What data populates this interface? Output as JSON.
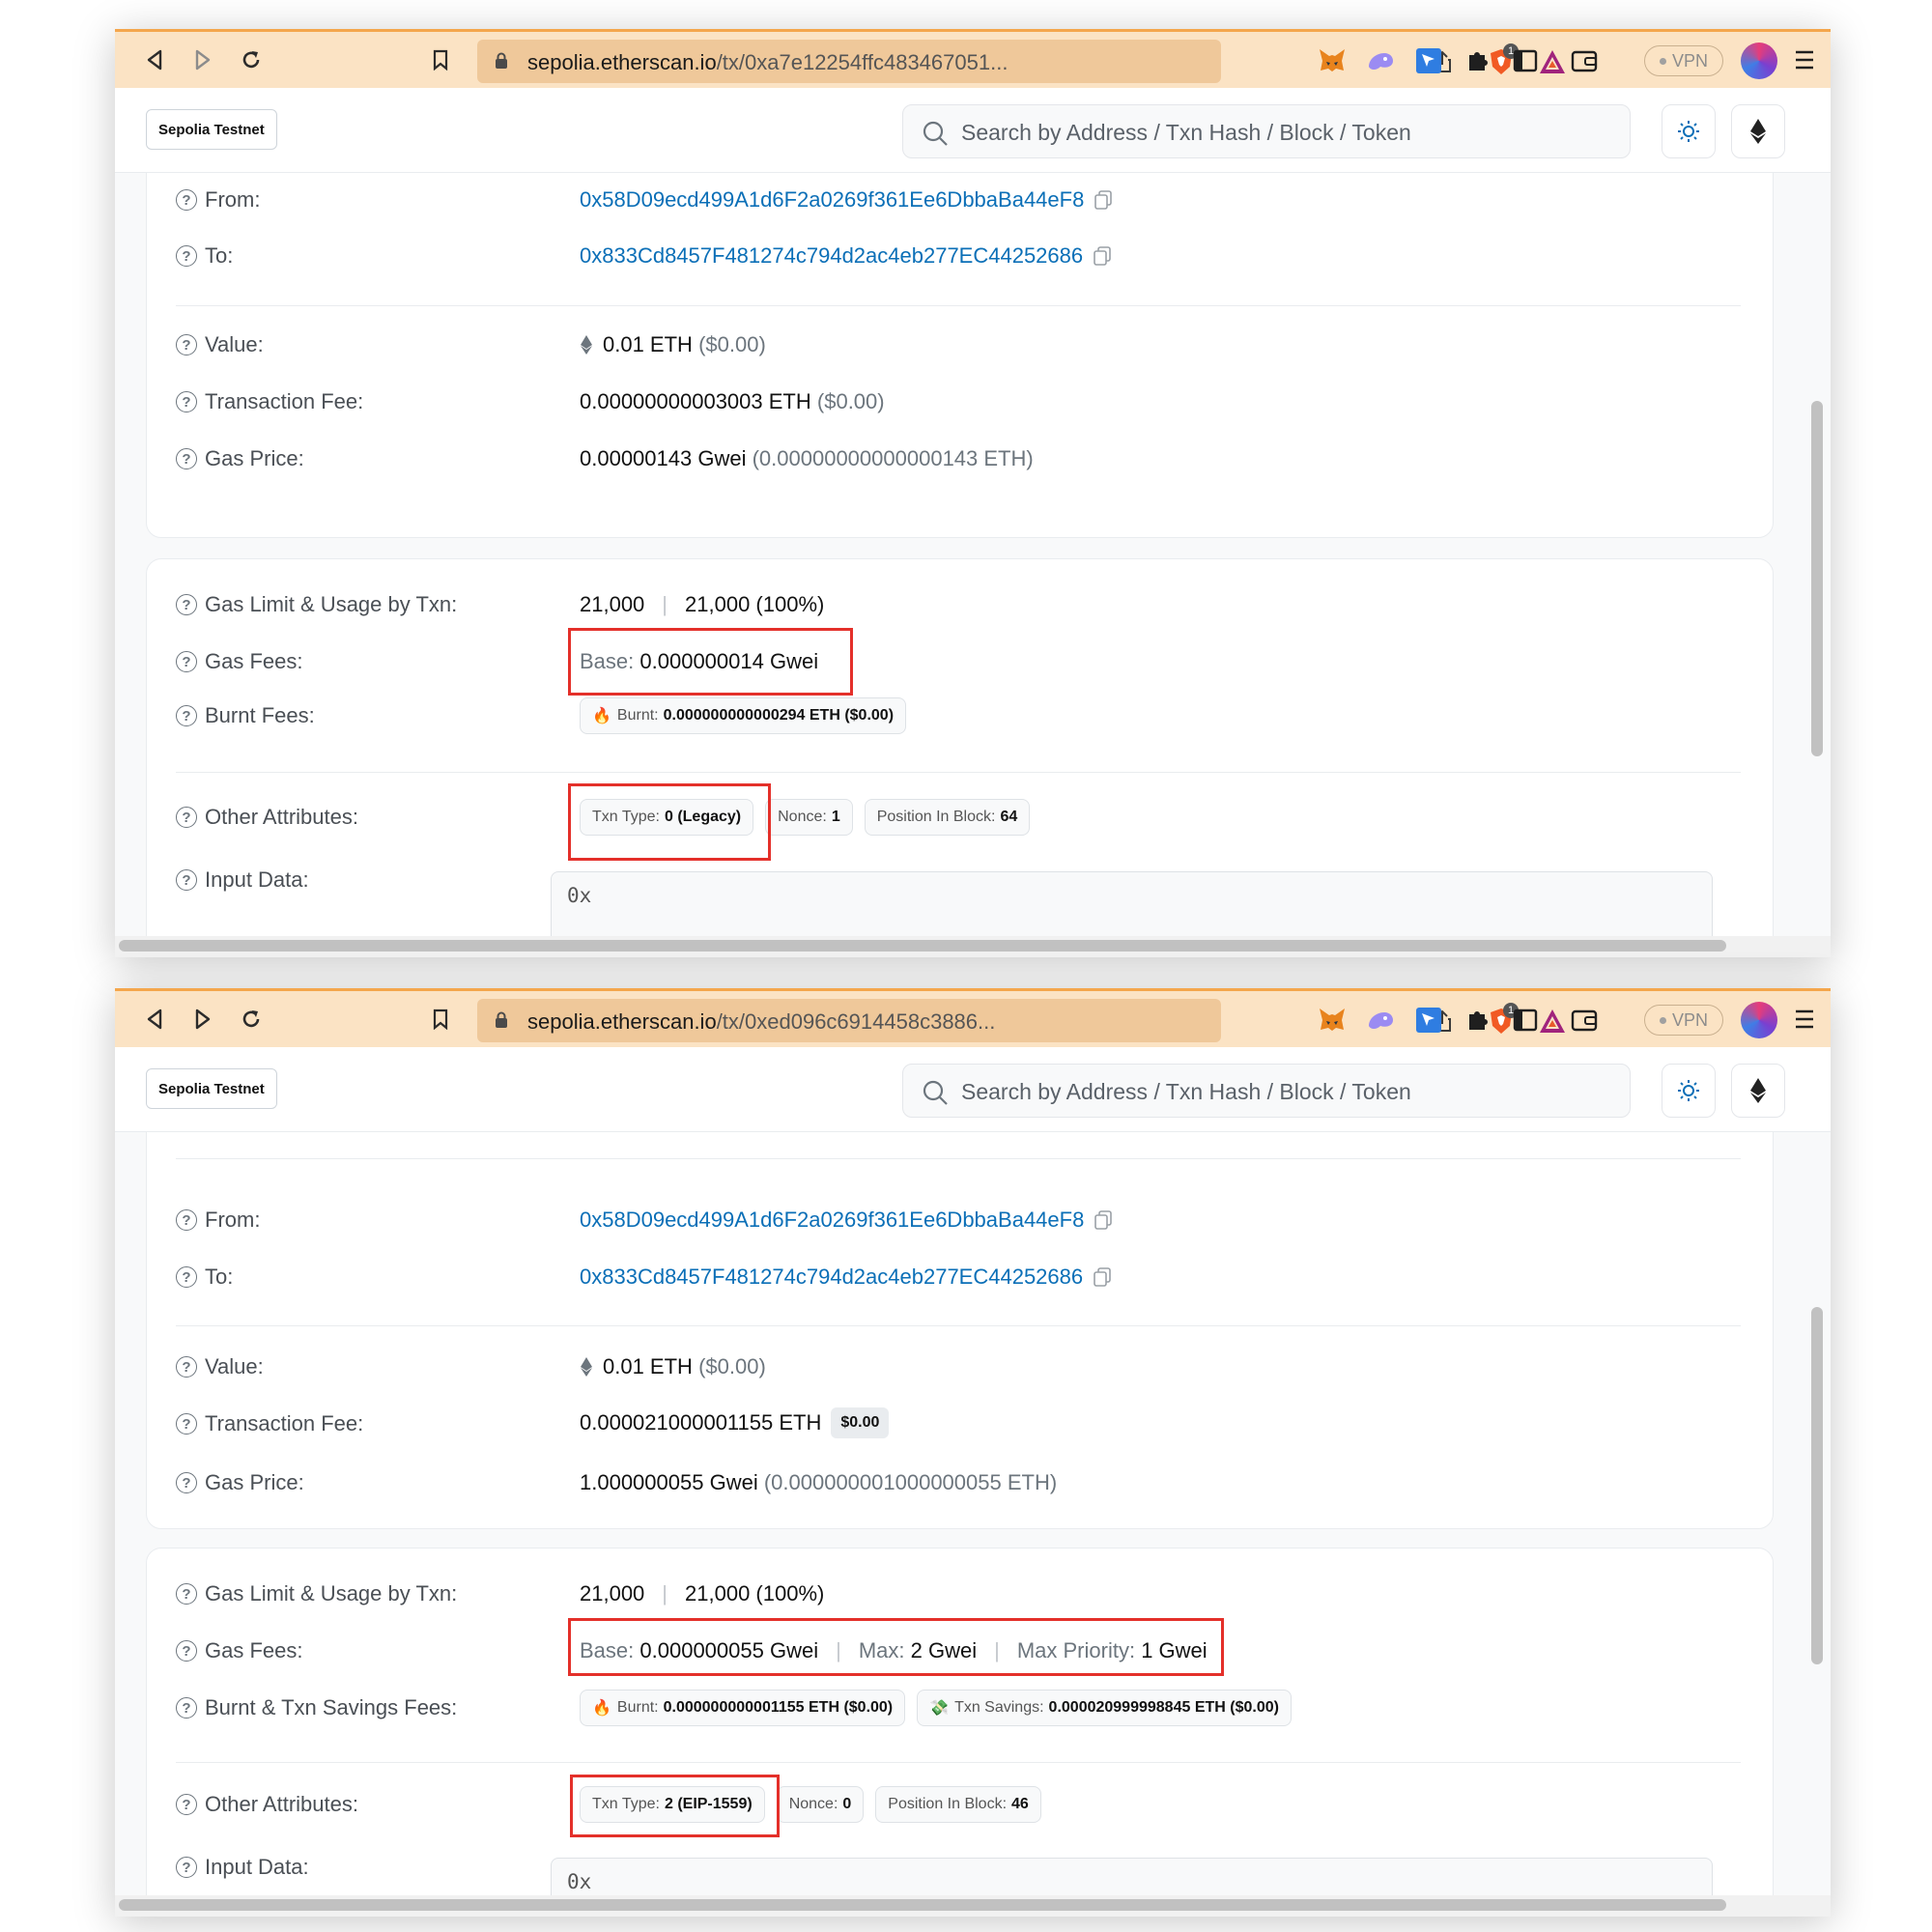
{
  "browser": {
    "urls": [
      {
        "host": "sepolia.etherscan.io",
        "path": "/tx/0xa7e12254ffc483467051..."
      },
      {
        "host": "sepolia.etherscan.io",
        "path": "/tx/0xed096c6914458c3886..."
      }
    ],
    "shields_count": "1",
    "vpn_label": "VPN"
  },
  "header": {
    "network_label": "Sepolia Testnet",
    "search_placeholder": "Search by Address / Txn Hash / Block / Token"
  },
  "labels": {
    "from": "From:",
    "to": "To:",
    "value": "Value:",
    "txn_fee": "Transaction Fee:",
    "gas_price": "Gas Price:",
    "gas_limit": "Gas Limit & Usage by Txn:",
    "gas_fees": "Gas Fees:",
    "burnt_fees": "Burnt Fees:",
    "burnt_savings_fees": "Burnt & Txn Savings Fees:",
    "other_attrs": "Other Attributes:",
    "input_data": "Input Data:",
    "base": "Base:",
    "max": "Max:",
    "max_priority": "Max Priority:",
    "burnt": "Burnt:",
    "txn_savings": "Txn Savings:",
    "txn_type": "Txn Type:",
    "nonce": "Nonce:",
    "position": "Position In Block:"
  },
  "tx1": {
    "from": "0x58D09ecd499A1d6F2a0269f361Ee6DbbaBa44eF8",
    "to": "0x833Cd8457F481274c794d2ac4eb277EC44252686",
    "value": "0.01 ETH",
    "value_usd": "($0.00)",
    "fee": "0.00000000003003 ETH",
    "fee_usd": "($0.00)",
    "gas_price": "0.00000143 Gwei",
    "gas_price_eth": "(0.00000000000000143 ETH)",
    "gas_limit": "21,000",
    "gas_usage": "21,000 (100%)",
    "base_fee": "0.000000014 Gwei",
    "burnt": "0.000000000000294 ETH ($0.00)",
    "txn_type": "0 (Legacy)",
    "nonce": "1",
    "position": "64",
    "input": "0x"
  },
  "tx2": {
    "from": "0x58D09ecd499A1d6F2a0269f361Ee6DbbaBa44eF8",
    "to": "0x833Cd8457F481274c794d2ac4eb277EC44252686",
    "value": "0.01 ETH",
    "value_usd": "($0.00)",
    "fee": "0.000021000001155 ETH",
    "fee_usd": "$0.00",
    "gas_price": "1.000000055 Gwei",
    "gas_price_eth": "(0.000000001000000055 ETH)",
    "gas_limit": "21,000",
    "gas_usage": "21,000 (100%)",
    "base_fee": "0.000000055 Gwei",
    "max_fee": "2 Gwei",
    "max_priority": "1 Gwei",
    "burnt": "0.000000000001155 ETH ($0.00)",
    "savings": "0.000020999998845 ETH ($0.00)",
    "txn_type": "2 (EIP-1559)",
    "nonce": "0",
    "position": "46",
    "input": "0x"
  }
}
